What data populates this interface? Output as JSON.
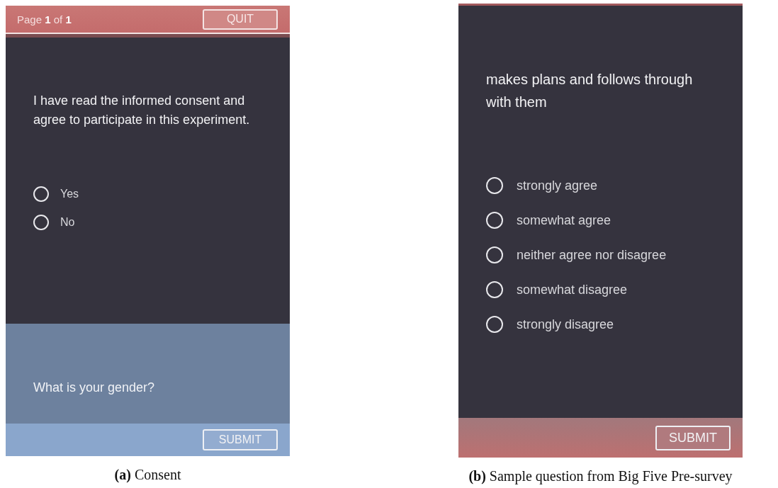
{
  "panels": [
    {
      "kind": "consent",
      "header": {
        "page_text": "Page **1** of **1**",
        "quit": "QUIT"
      },
      "question": "I have read the informed consent and agree to participate in this experiment.",
      "options": [
        {
          "label": "Yes",
          "selected": false
        },
        {
          "label": "No",
          "selected": false
        }
      ],
      "next_question": "What is your gender?",
      "submit": "SUBMIT",
      "caption": "**(a)** Consent"
    },
    {
      "kind": "survey",
      "question": "makes plans and follows through with them",
      "options": [
        {
          "label": "strongly agree",
          "selected": false
        },
        {
          "label": "somewhat agree",
          "selected": false
        },
        {
          "label": "neither agree nor disagree",
          "selected": false
        },
        {
          "label": "somewhat disagree",
          "selected": false
        },
        {
          "label": "strongly disagree",
          "selected": false
        }
      ],
      "submit": "SUBMIT",
      "caption": "**(b)** Sample question from Big Five Pre-survey"
    }
  ]
}
